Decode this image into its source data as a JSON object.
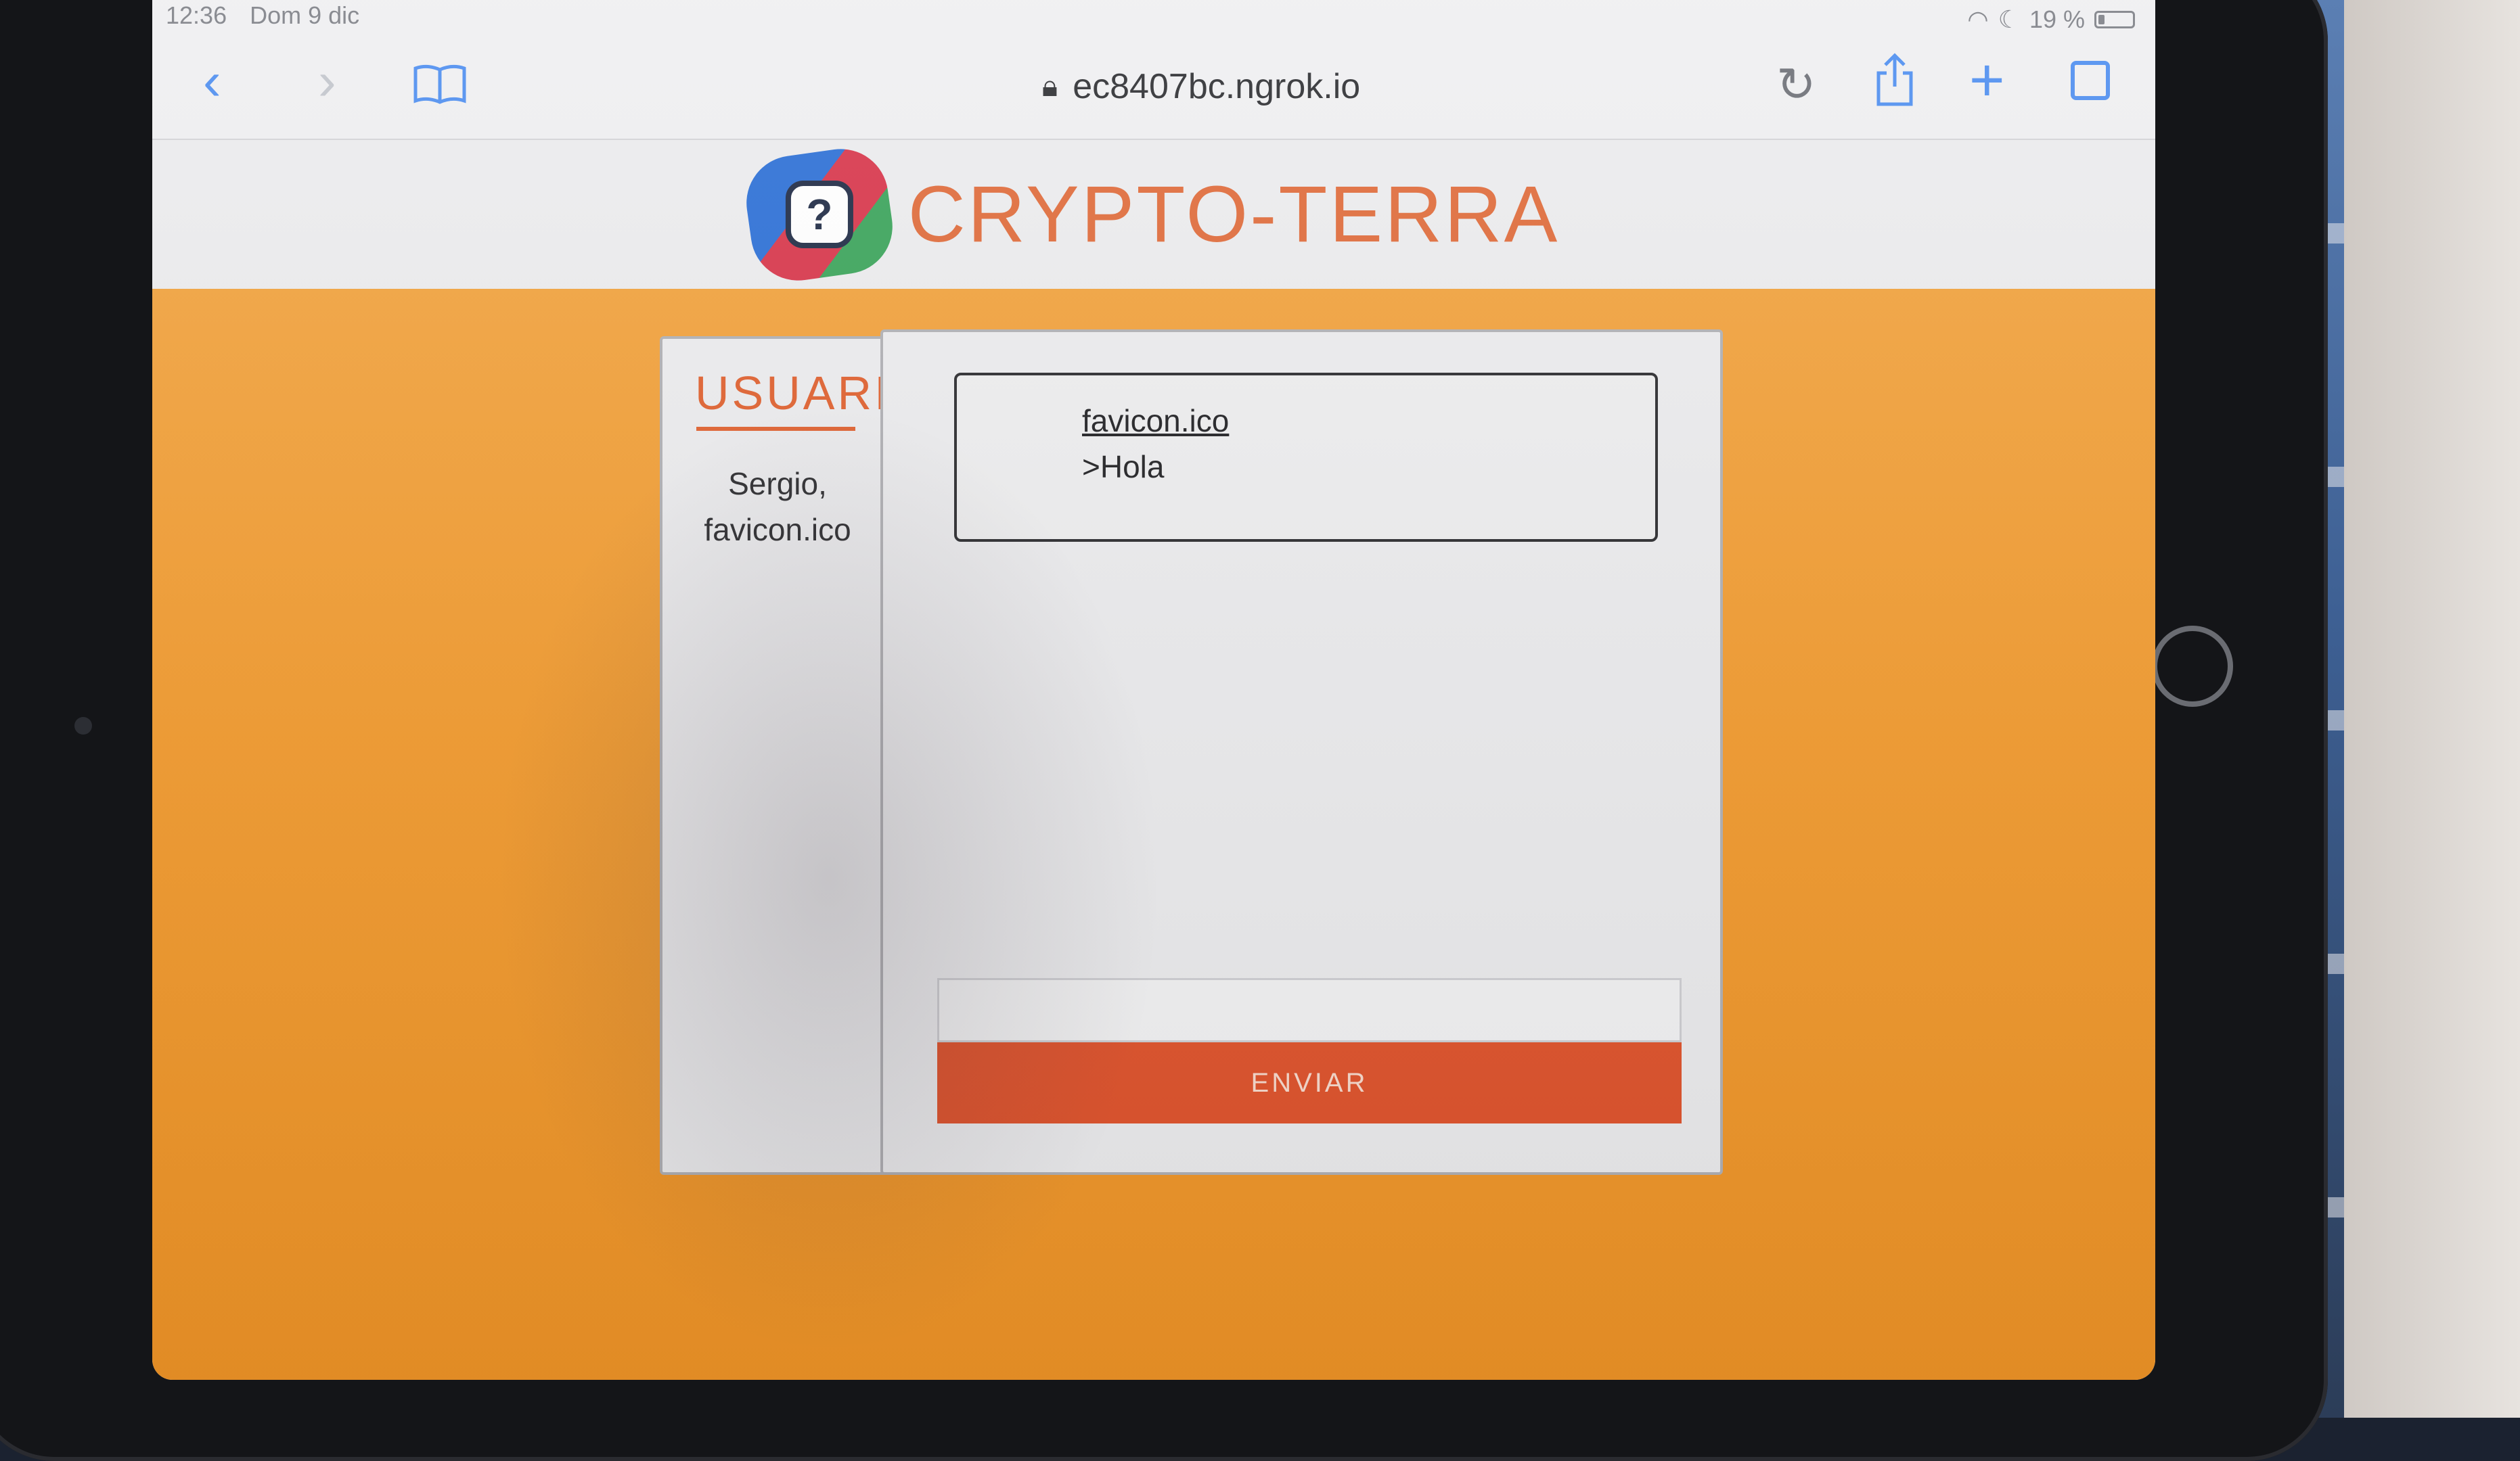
{
  "status_bar": {
    "time": "12:36",
    "date": "Dom 9 dic",
    "battery_percent": "19 %",
    "battery_level": 0.19
  },
  "browser": {
    "url": "ec8407bc.ngrok.io",
    "icons": {
      "back": "chevron-left-icon",
      "forward": "chevron-right-icon",
      "bookmarks": "book-icon",
      "lock": "lock-icon",
      "reload": "reload-icon",
      "share": "share-icon",
      "new_tab": "plus-icon",
      "tabs": "tabs-icon"
    }
  },
  "site": {
    "title": "CRYPTO-TERRA",
    "logo_mark": "?"
  },
  "users_panel": {
    "heading": "USUARIO",
    "users": [
      "Sergio,",
      "favicon.ico"
    ]
  },
  "chat": {
    "messages": [
      {
        "user": "favicon.ico",
        "text": ">Hola"
      }
    ],
    "input_value": "",
    "send_label": "ENVIAR"
  },
  "colors": {
    "accent": "#e0602e",
    "send_button": "#e0532c",
    "page_background": "#f39b2e",
    "ios_blue": "#4d8ef0"
  }
}
